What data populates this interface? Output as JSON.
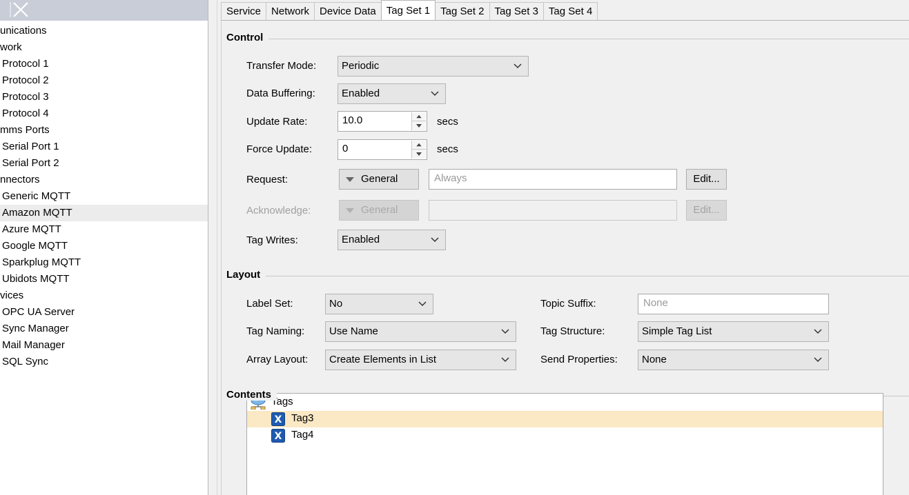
{
  "tree": {
    "items": [
      {
        "label": "unications",
        "indent": 0
      },
      {
        "label": "work",
        "indent": 0
      },
      {
        "label": "Protocol 1",
        "indent": 3
      },
      {
        "label": "Protocol 2",
        "indent": 3
      },
      {
        "label": "Protocol 3",
        "indent": 3
      },
      {
        "label": "Protocol 4",
        "indent": 3
      },
      {
        "label": "mms Ports",
        "indent": 0
      },
      {
        "label": "Serial Port 1",
        "indent": 3
      },
      {
        "label": "Serial Port 2",
        "indent": 3
      },
      {
        "label": "nnectors",
        "indent": 0
      },
      {
        "label": "Generic MQTT",
        "indent": 3
      },
      {
        "label": "Amazon MQTT",
        "indent": 3,
        "selected": true
      },
      {
        "label": "Azure MQTT",
        "indent": 3
      },
      {
        "label": "Google MQTT",
        "indent": 3
      },
      {
        "label": "Sparkplug MQTT",
        "indent": 3
      },
      {
        "label": "Ubidots MQTT",
        "indent": 3
      },
      {
        "label": "vices",
        "indent": 0
      },
      {
        "label": "OPC UA Server",
        "indent": 3
      },
      {
        "label": "Sync Manager",
        "indent": 3
      },
      {
        "label": "Mail Manager",
        "indent": 3
      },
      {
        "label": "SQL Sync",
        "indent": 3
      }
    ]
  },
  "tabs": [
    {
      "label": "Service"
    },
    {
      "label": "Network"
    },
    {
      "label": "Device Data"
    },
    {
      "label": "Tag Set 1",
      "active": true
    },
    {
      "label": "Tag Set 2"
    },
    {
      "label": "Tag Set 3"
    },
    {
      "label": "Tag Set 4"
    }
  ],
  "control": {
    "heading": "Control",
    "transfer_mode_label": "Transfer Mode:",
    "transfer_mode_value": "Periodic",
    "data_buffering_label": "Data Buffering:",
    "data_buffering_value": "Enabled",
    "update_rate_label": "Update Rate:",
    "update_rate_value": "10.0",
    "update_rate_unit": "secs",
    "force_update_label": "Force Update:",
    "force_update_value": "0",
    "force_update_unit": "secs",
    "request_label": "Request:",
    "request_type": "General",
    "request_placeholder": "Always",
    "request_edit": "Edit...",
    "acknowledge_label": "Acknowledge:",
    "acknowledge_type": "General",
    "acknowledge_edit": "Edit...",
    "tag_writes_label": "Tag Writes:",
    "tag_writes_value": "Enabled"
  },
  "layout": {
    "heading": "Layout",
    "label_set_label": "Label Set:",
    "label_set_value": "No",
    "topic_suffix_label": "Topic Suffix:",
    "topic_suffix_placeholder": "None",
    "tag_naming_label": "Tag Naming:",
    "tag_naming_value": "Use Name",
    "tag_structure_label": "Tag Structure:",
    "tag_structure_value": "Simple Tag List",
    "array_layout_label": "Array Layout:",
    "array_layout_value": "Create Elements in List",
    "send_properties_label": "Send Properties:",
    "send_properties_value": "None"
  },
  "contents": {
    "heading": "Contents",
    "root": "Tags",
    "items": [
      {
        "label": "Tag3",
        "icon": "tag-x-icon",
        "selected": true
      },
      {
        "label": "Tag4",
        "icon": "tag-x-icon"
      }
    ]
  },
  "colors": {
    "accent_blue": "#1f5bb0",
    "selection_highlight": "#fbe8c4",
    "panel_bg": "#f0f0f0"
  }
}
